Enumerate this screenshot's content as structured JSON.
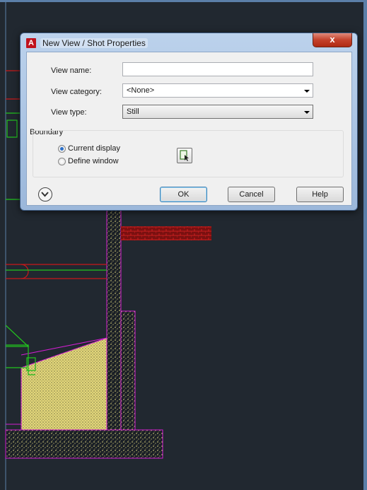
{
  "dialog": {
    "title": "New View / Shot Properties",
    "app_icon_letter": "A",
    "close_glyph": "x",
    "view_name": {
      "label": "View name:",
      "value": ""
    },
    "view_category": {
      "label": "View category:",
      "value": "<None>"
    },
    "view_type": {
      "label": "View type:",
      "value": "Still"
    },
    "boundary": {
      "label": "Boundary",
      "options": [
        "Current display",
        "Define window"
      ],
      "selected": "Current display"
    },
    "buttons": {
      "ok": "OK",
      "cancel": "Cancel",
      "help": "Help"
    }
  },
  "icons": {
    "expand": "chevron-down-circle-icon",
    "pick": "define-window-pick-icon",
    "app": "autocad-app-icon"
  },
  "colors": {
    "canvas_bg": "#212830",
    "cad_green": "#22c41e",
    "cad_red": "#c81919",
    "cad_magenta": "#d21ed2",
    "cad_yellow": "#e6dc82"
  }
}
